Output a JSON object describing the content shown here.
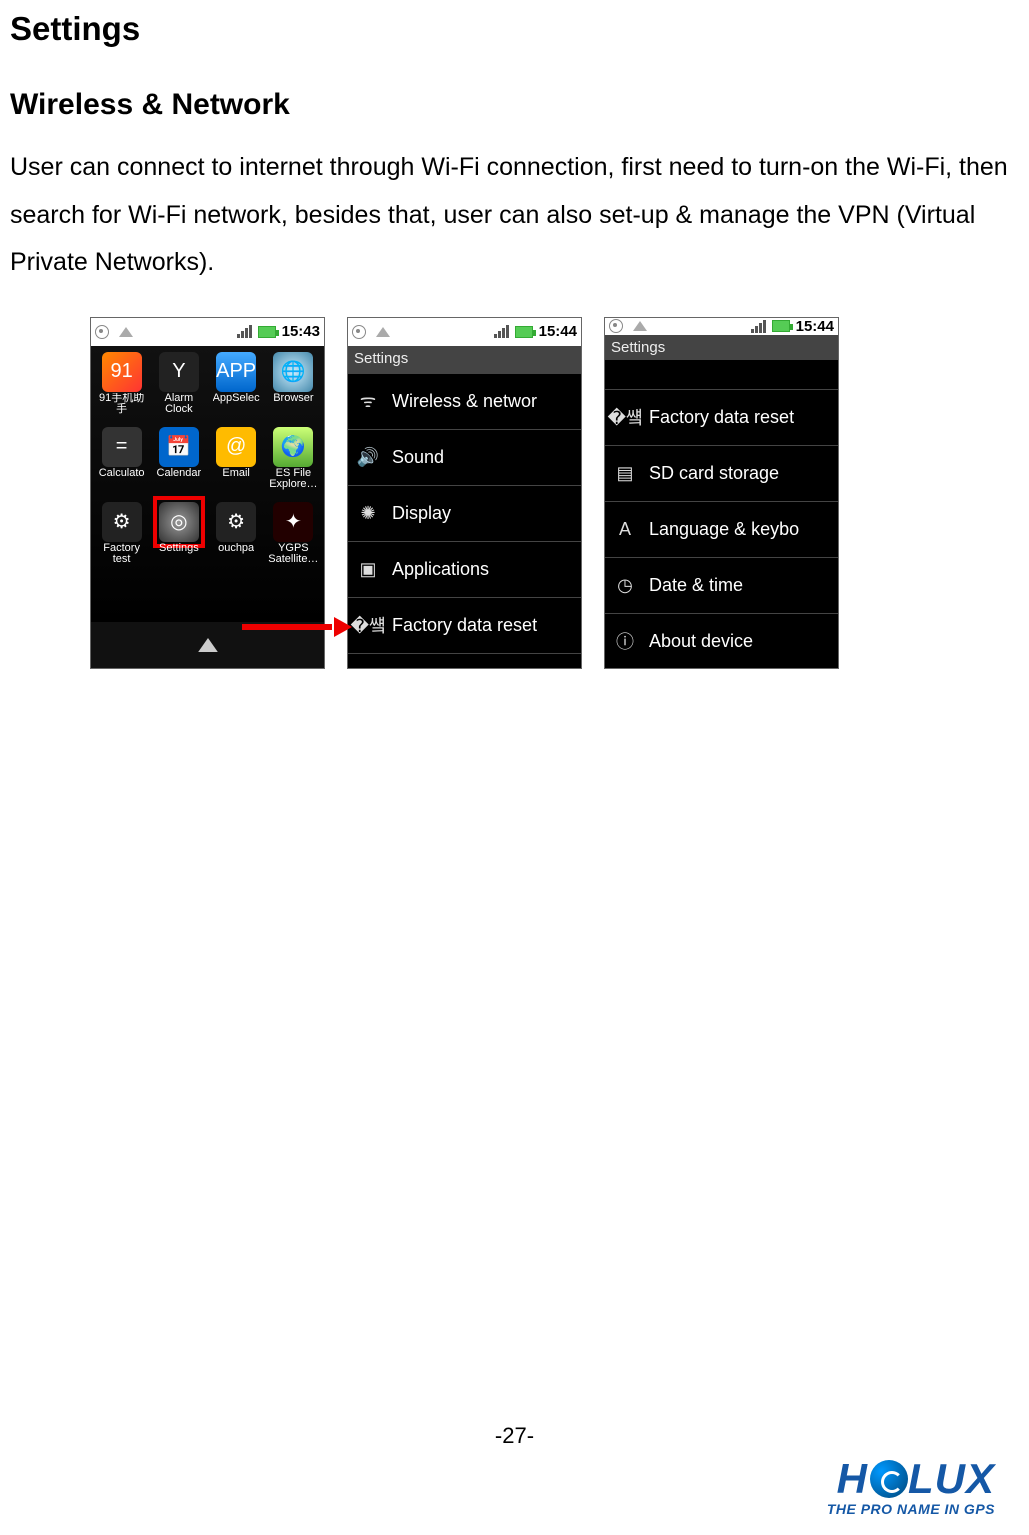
{
  "page": {
    "title": "Settings",
    "section": "Wireless & Network",
    "body": "User can connect to internet through Wi-Fi connection, first need to turn-on the Wi-Fi, then search for Wi-Fi network, besides that, user can also set-up & manage the VPN (Virtual Private Networks).",
    "page_number_prefix": "-",
    "page_number": "27",
    "page_number_suffix": "-"
  },
  "logo": {
    "name": "HOLUX",
    "tagline": "THE PRO NAME IN GPS"
  },
  "phone1": {
    "time": "15:43",
    "apps": [
      {
        "label": "91手机助手",
        "iconClass": "ic-91",
        "glyph": "91"
      },
      {
        "label": "Alarm Clock",
        "iconClass": "ic-alarm",
        "glyph": "Y"
      },
      {
        "label": "AppSelec",
        "iconClass": "ic-appsel",
        "glyph": "APP"
      },
      {
        "label": "Browser",
        "iconClass": "ic-browser",
        "glyph": "🌐"
      },
      {
        "label": "Calculato",
        "iconClass": "ic-calc",
        "glyph": "="
      },
      {
        "label": "Calendar",
        "iconClass": "ic-cal",
        "glyph": "📅"
      },
      {
        "label": "Email",
        "iconClass": "ic-email",
        "glyph": "@"
      },
      {
        "label": "ES File Explore…",
        "iconClass": "ic-es",
        "glyph": "🌍"
      },
      {
        "label": "Factory test",
        "iconClass": "ic-fact",
        "glyph": "⚙"
      },
      {
        "label": "Settings",
        "iconClass": "ic-set",
        "glyph": "◎",
        "highlight": true
      },
      {
        "label": "ouchpa",
        "iconClass": "ic-tp",
        "glyph": "⚙"
      },
      {
        "label": "YGPS Satellite…",
        "iconClass": "ic-gps",
        "glyph": "✦"
      }
    ]
  },
  "phone2": {
    "time": "15:44",
    "title": "Settings",
    "items": [
      {
        "icon": "ᯤ",
        "label": "Wireless & networ"
      },
      {
        "icon": "🔊",
        "label": "Sound"
      },
      {
        "icon": "✺",
        "label": "Display"
      },
      {
        "icon": "▣",
        "label": "Applications"
      },
      {
        "icon": "�썤",
        "label": "Factory data reset"
      }
    ]
  },
  "phone3": {
    "time": "15:44",
    "title": "Settings",
    "items": [
      {
        "icon": "�썤",
        "label": "Factory data reset"
      },
      {
        "icon": "▤",
        "label": "SD card storage"
      },
      {
        "icon": "A",
        "label": "Language & keybo"
      },
      {
        "icon": "◷",
        "label": "Date & time"
      },
      {
        "icon": "ⓘ",
        "label": "About device"
      }
    ]
  }
}
